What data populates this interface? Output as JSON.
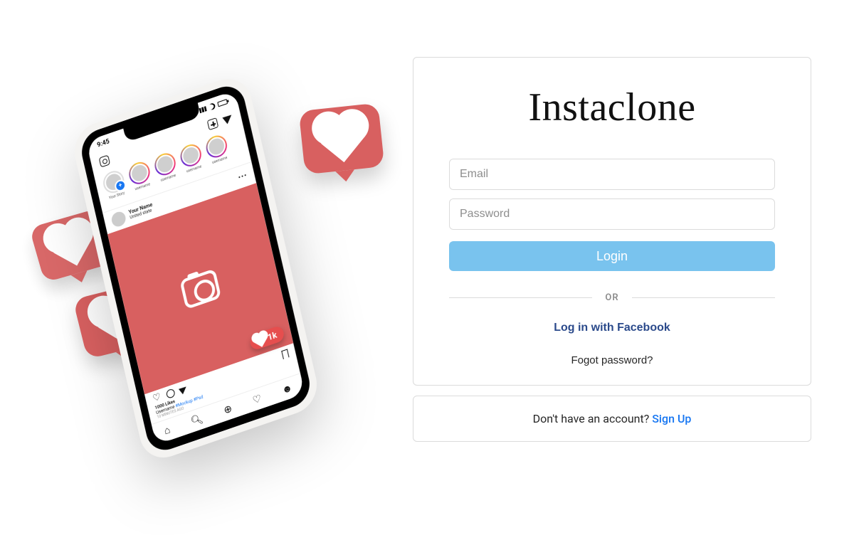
{
  "brand": "Instaclone",
  "form": {
    "email_placeholder": "Email",
    "password_placeholder": "Password",
    "login_button": "Login",
    "divider_text": "OR",
    "facebook_login": "Log in with Facebook",
    "forgot_password": "Fogot password?"
  },
  "signup": {
    "prompt": "Don't have an account? ",
    "link": "Sign Up"
  },
  "illustration": {
    "statusbar_time": "9:45",
    "story_your": "Your Story",
    "story_label": "username",
    "post_username": "Your Name",
    "post_location": "United state",
    "likes_line": "1000 Likes",
    "caption_user": "Username",
    "caption_hash": "#Mockup #Psd",
    "timestamp": "10 MINUTES AGO",
    "like_badge": "1k"
  }
}
